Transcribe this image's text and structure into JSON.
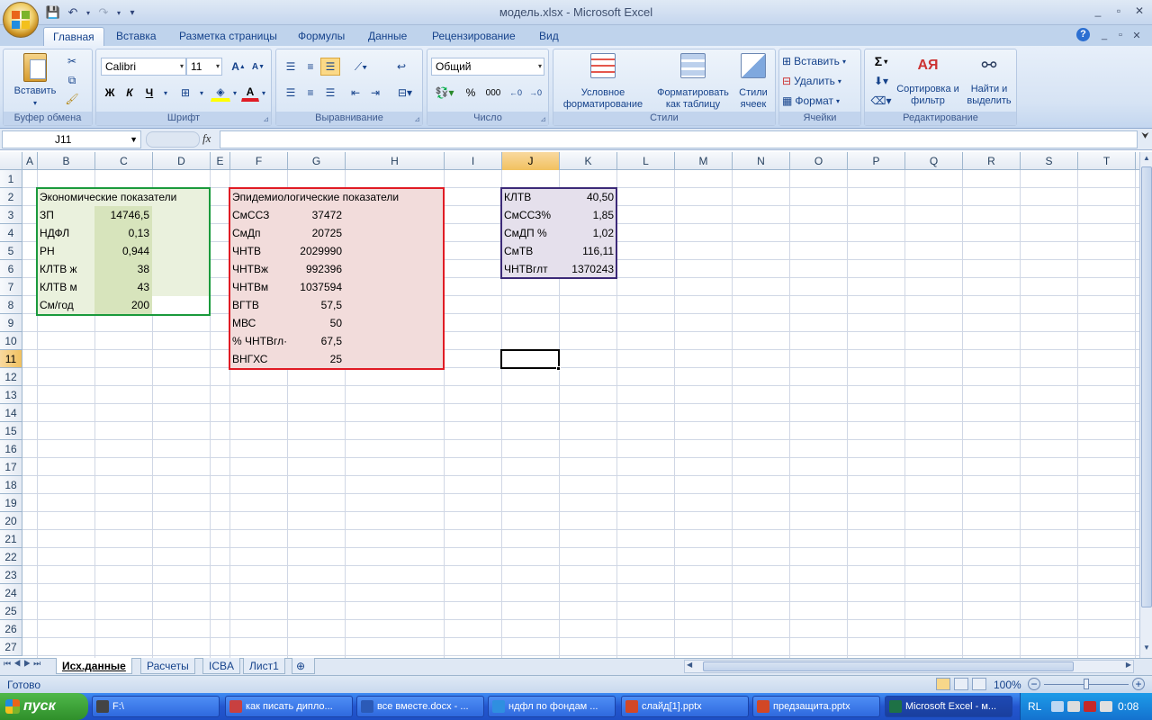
{
  "app": {
    "title": "модель.xlsx - Microsoft Excel",
    "help_icon": "?",
    "window_min": "_",
    "window_max": "▫",
    "window_close": "✕"
  },
  "tabs": [
    "Главная",
    "Вставка",
    "Разметка страницы",
    "Формулы",
    "Данные",
    "Рецензирование",
    "Вид"
  ],
  "ribbon": {
    "clipboard": {
      "paste": "Вставить",
      "label": "Буфер обмена"
    },
    "font": {
      "name": "Calibri",
      "size": "11",
      "bold": "Ж",
      "italic": "К",
      "underline": "Ч",
      "label": "Шрифт"
    },
    "alignment": {
      "label": "Выравнивание"
    },
    "number": {
      "format": "Общий",
      "percent": "%",
      "thousands": "000",
      "label": "Число"
    },
    "styles": {
      "cond_format": "Условное форматирование",
      "format_table": "Форматировать как таблицу",
      "cell_styles": "Стили ячеек",
      "label": "Стили"
    },
    "cells": {
      "insert": "Вставить",
      "delete": "Удалить",
      "format": "Формат",
      "label": "Ячейки"
    },
    "editing": {
      "sort": "Сортировка и фильтр",
      "find": "Найти и выделить",
      "label": "Редактирование",
      "sum": "Σ"
    }
  },
  "formula_bar": {
    "name_box": "J11",
    "fx": "fx",
    "formula": ""
  },
  "columns": [
    "A",
    "B",
    "C",
    "D",
    "E",
    "F",
    "G",
    "H",
    "I",
    "J",
    "K",
    "L",
    "M",
    "N",
    "O",
    "P",
    "Q",
    "R",
    "S",
    "T"
  ],
  "rows": [
    "1",
    "2",
    "3",
    "4",
    "5",
    "6",
    "7",
    "8",
    "9",
    "10",
    "11",
    "12",
    "13",
    "14",
    "15",
    "16",
    "17",
    "18",
    "19",
    "20",
    "21",
    "22",
    "23",
    "24",
    "25",
    "26",
    "27"
  ],
  "econ": {
    "title": "Экономические показатели",
    "items": [
      {
        "label": "ЗП",
        "value": "14746,5"
      },
      {
        "label": "НДФЛ",
        "value": "0,13"
      },
      {
        "label": "РН",
        "value": "0,944"
      },
      {
        "label": "КЛТВ ж",
        "value": "38"
      },
      {
        "label": "КЛТВ м",
        "value": "43"
      },
      {
        "label": "См/год",
        "value": "200"
      }
    ]
  },
  "epi": {
    "title": "Эпидемиологические показатели",
    "items": [
      {
        "label": "СмССЗ",
        "value": "37472"
      },
      {
        "label": "СмДп",
        "value": "20725"
      },
      {
        "label": "ЧНТВ",
        "value": "2029990"
      },
      {
        "label": "ЧНТВж",
        "value": "992396"
      },
      {
        "label": "ЧНТВм",
        "value": "1037594"
      },
      {
        "label": "ВГТВ",
        "value": "57,5"
      },
      {
        "label": "МВС",
        "value": "50"
      },
      {
        "label": "% ЧНТВгл·",
        "value": "67,5"
      },
      {
        "label": "ВНГХС",
        "value": "25"
      }
    ]
  },
  "results": {
    "items": [
      {
        "label": "КЛТВ",
        "value": "40,50"
      },
      {
        "label": "СмССЗ%",
        "value": "1,85"
      },
      {
        "label": "СмДП %",
        "value": "1,02"
      },
      {
        "label": "СмТВ",
        "value": "116,11"
      },
      {
        "label": "ЧНТВглт",
        "value": "1370243"
      }
    ]
  },
  "sheets": [
    "Исх.данные",
    "Расчеты",
    "ICBA",
    "Лист1"
  ],
  "status": {
    "ready": "Готово",
    "zoom": "100%"
  },
  "taskbar": {
    "start": "пуск",
    "items": [
      "F:\\",
      "как писать дипло...",
      "все вместе.docx - ...",
      "ндфл по фондам ...",
      "слайд[1].pptx",
      "предзащита.pptx",
      "Microsoft Excel - м..."
    ],
    "lang": "RL",
    "time": "0:08"
  },
  "colors": {
    "econ_border": "#1a9a3c",
    "econ_fill": "#eaf1dd",
    "econ_value_fill": "#d7e4bc",
    "epi_border": "#e01b24",
    "epi_fill": "#f2dcdb",
    "res_border": "#3c2a78",
    "res_fill": "#e5e0ec"
  }
}
